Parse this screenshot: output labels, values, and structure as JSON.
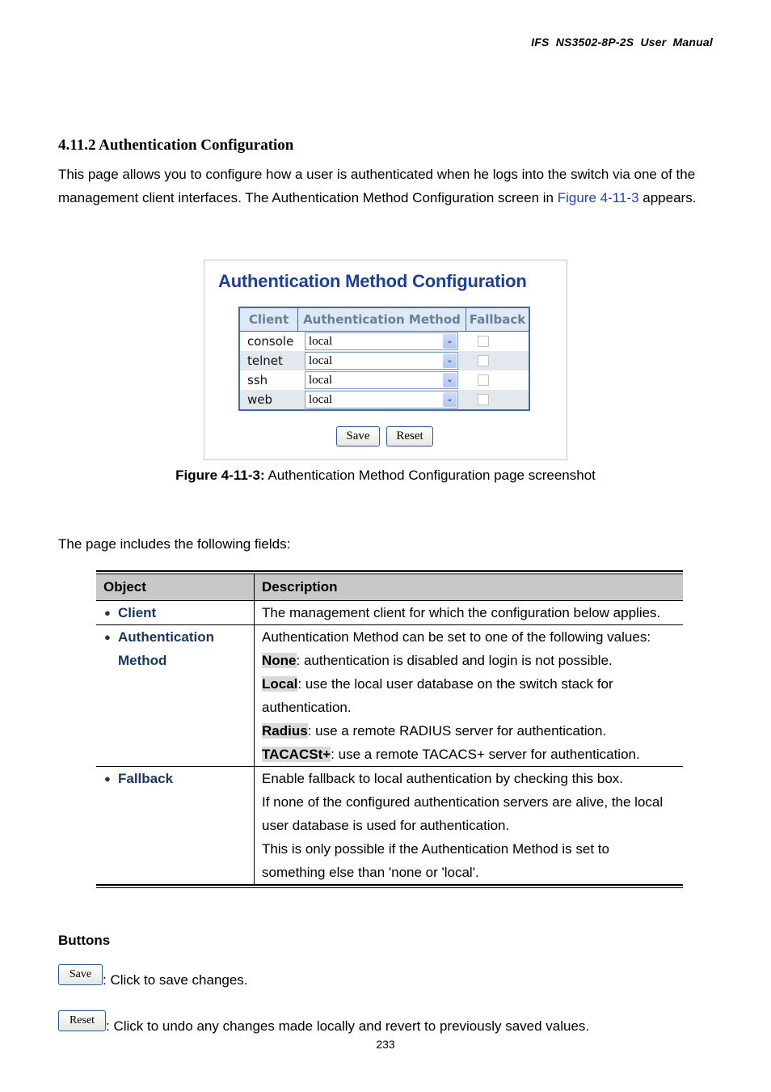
{
  "header": {
    "running_title": "IFS  NS3502-8P-2S  User  Manual"
  },
  "section": {
    "title": "4.11.2 Authentication Configuration",
    "intro_before_link": "This page allows you to configure how a user is authenticated when he logs into the switch via one of the management client interfaces. The Authentication Method Configuration screen in ",
    "intro_link": "Figure 4-11-3",
    "intro_after_link": " appears."
  },
  "figure": {
    "title": "Authentication Method Configuration",
    "columns": [
      "Client",
      "Authentication Method",
      "Fallback"
    ],
    "rows": [
      {
        "client": "console",
        "method": "local",
        "fallback": false
      },
      {
        "client": "telnet",
        "method": "local",
        "fallback": false
      },
      {
        "client": "ssh",
        "method": "local",
        "fallback": false
      },
      {
        "client": "web",
        "method": "local",
        "fallback": false
      }
    ],
    "save_label": "Save",
    "reset_label": "Reset",
    "caption_label": "Figure 4-11-3:",
    "caption_text": " Authentication Method Configuration page screenshot"
  },
  "fields_intro": "The page includes the following fields:",
  "fields_table": {
    "headers": [
      "Object",
      "Description"
    ],
    "rows": [
      {
        "object": "Client",
        "lines": [
          "The management client for which the configuration below applies."
        ]
      },
      {
        "object": "Authentication Method",
        "intro": "Authentication Method can be set to one of the following values:",
        "values": [
          {
            "term": "None",
            "text": ": authentication is disabled and login is not possible."
          },
          {
            "term": "Local",
            "text": ": use the local user database on the switch stack for authentication."
          },
          {
            "term": "Radius",
            "text": ": use a remote RADIUS server for authentication."
          },
          {
            "term": "TACACSt+",
            "text": ": use a remote TACACS+ server for authentication."
          }
        ]
      },
      {
        "object": "Fallback",
        "lines": [
          "Enable fallback to local authentication by checking this box.",
          "If none of the configured authentication servers are alive, the local user database is used for authentication.",
          "This is only possible if the Authentication Method is set to something else than 'none or 'local'."
        ]
      }
    ]
  },
  "buttons_section": {
    "heading": "Buttons",
    "save_label": "Save",
    "save_desc": ": Click to save changes.",
    "reset_label": "Reset",
    "reset_desc": ": Click to undo any changes made locally and revert to previously saved values."
  },
  "page_number": "233"
}
